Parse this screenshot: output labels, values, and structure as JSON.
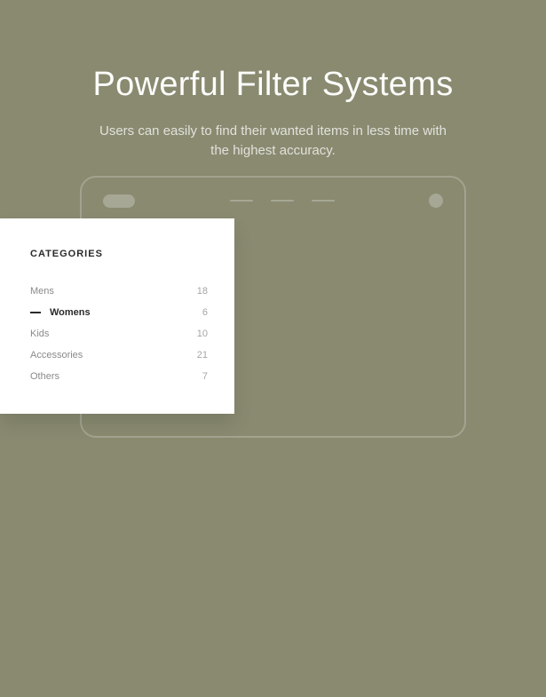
{
  "hero": {
    "title": "Powerful Filter Systems",
    "subtitle": "Users can easily to find their wanted items in less time with the highest accuracy."
  },
  "categories": {
    "heading": "CATEGORIES",
    "items": [
      {
        "label": "Mens",
        "count": "18",
        "active": false
      },
      {
        "label": "Womens",
        "count": "6",
        "active": true
      },
      {
        "label": "Kids",
        "count": "10",
        "active": false
      },
      {
        "label": "Accessories",
        "count": "21",
        "active": false
      },
      {
        "label": "Others",
        "count": "7",
        "active": false
      }
    ]
  }
}
